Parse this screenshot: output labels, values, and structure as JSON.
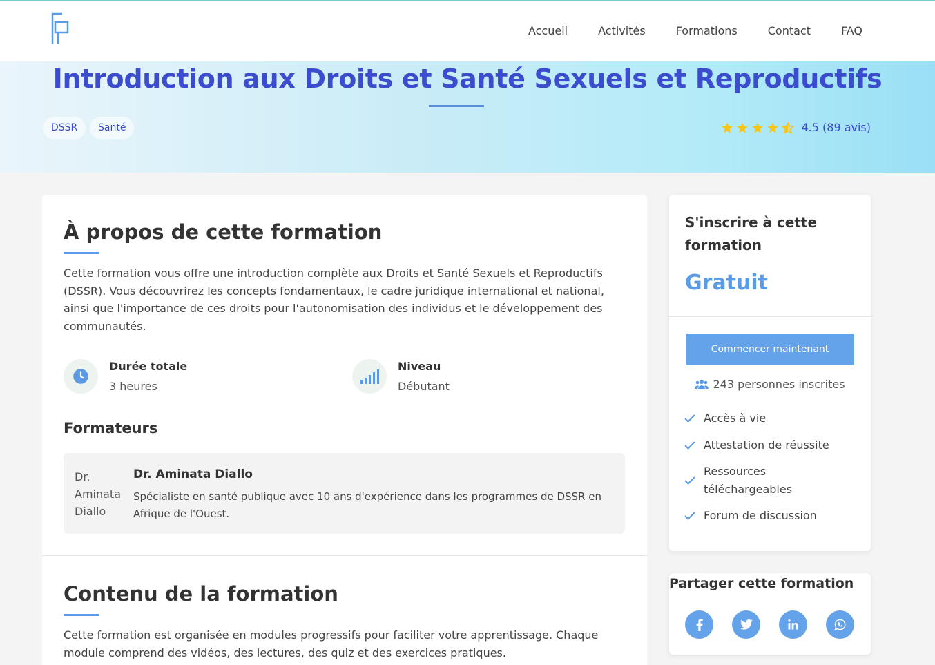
{
  "nav": {
    "items": [
      "Accueil",
      "Activités",
      "Formations",
      "Contact",
      "FAQ"
    ]
  },
  "hero": {
    "title": "Introduction aux Droits et Santé Sexuels et Reproductifs",
    "tags": [
      "DSSR",
      "Santé"
    ],
    "rating": 4.5,
    "rating_text": "4.5 (89 avis)"
  },
  "about": {
    "title": "À propos de cette formation",
    "description": "Cette formation vous offre une introduction complète aux Droits et Santé Sexuels et Reproductifs (DSSR). Vous découvrirez les concepts fondamentaux, le cadre juridique international et national, ainsi que l'importance de ces droits pour l'autonomisation des individus et le développement des communautés.",
    "duration_label": "Durée totale",
    "duration_value": "3 heures",
    "level_label": "Niveau",
    "level_value": "Débutant"
  },
  "trainers": {
    "title": "Formateurs",
    "items": [
      {
        "avatar_alt": "Dr. Aminata Diallo",
        "name": "Dr. Aminata Diallo",
        "bio": "Spécialiste en santé publique avec 10 ans d'expérience dans les programmes de DSSR en Afrique de l'Ouest."
      }
    ]
  },
  "content": {
    "title": "Contenu de la formation",
    "description": "Cette formation est organisée en modules progressifs pour faciliter votre apprentissage. Chaque module comprend des vidéos, des lectures, des quiz et des exercices pratiques."
  },
  "enroll": {
    "title": "S'inscrire à cette formation",
    "price": "Gratuit",
    "button": "Commencer maintenant",
    "enrolled": "243 personnes inscrites",
    "features": [
      "Accès à vie",
      "Attestation de réussite",
      "Ressources téléchargeables",
      "Forum de discussion"
    ]
  },
  "share": {
    "title": "Partager cette formation",
    "networks": [
      "facebook-icon",
      "twitter-icon",
      "linkedin-icon",
      "whatsapp-icon"
    ]
  },
  "colors": {
    "accent": "#64a2ea",
    "title": "#3b4ccf",
    "star": "#f5c518"
  }
}
